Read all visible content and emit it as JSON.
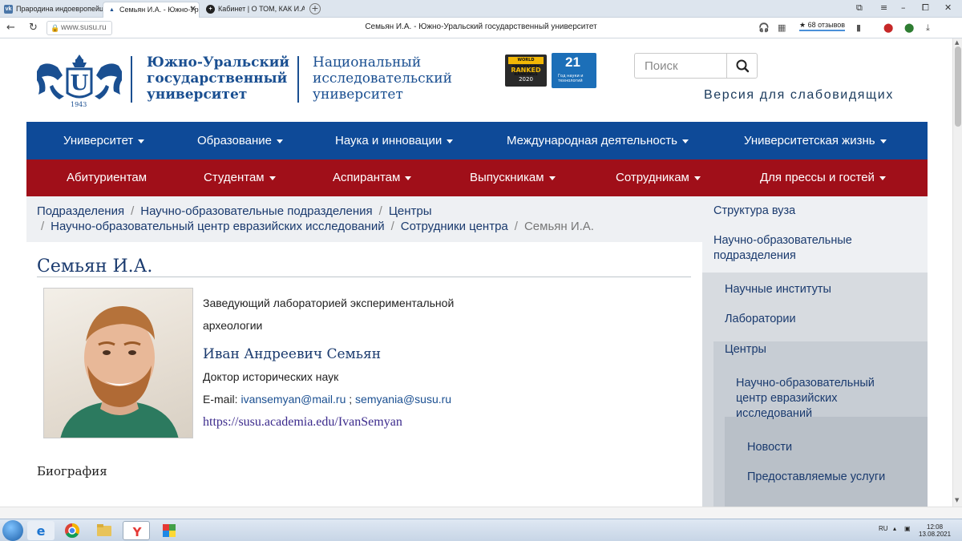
{
  "browser": {
    "tabs": [
      {
        "label": "Прародина индоевропейцев",
        "active": false,
        "favicon": "vk-icon"
      },
      {
        "label": "Семьян И.А. - Южно-Уральский",
        "active": true,
        "favicon": "susu-icon"
      },
      {
        "label": "Кабинет | О ТОМ, КАК И.А.",
        "active": false,
        "favicon": "cabinet-icon"
      }
    ],
    "url": "www.susu.ru",
    "page_title": "Семьян И.А. - Южно-Уральский государственный университет",
    "reviews": "68 отзывов"
  },
  "header": {
    "univ_name": [
      "Южно-Уральский",
      "государственный",
      "университет"
    ],
    "univ_sub": [
      "Национальный",
      "исследовательский",
      "университет"
    ],
    "founded": "1943",
    "badge_ranked": "RANKED",
    "badge_ranked_top": "WORLD UNIVERSITY RANKINGS",
    "badge_ranked_year": "2020",
    "badge_21": "21",
    "badge_21_text": "Год науки и технологий",
    "search_placeholder": "Поиск",
    "vision_link": "Версия для слабовидящих"
  },
  "menu_main": [
    {
      "label": "Университет",
      "dropdown": true
    },
    {
      "label": "Образование",
      "dropdown": true
    },
    {
      "label": "Наука и инновации",
      "dropdown": true
    },
    {
      "label": "Международная деятельность",
      "dropdown": true
    },
    {
      "label": "Университетская жизнь",
      "dropdown": true
    }
  ],
  "menu_audience": [
    {
      "label": "Абитуриентам",
      "dropdown": false
    },
    {
      "label": "Студентам",
      "dropdown": true
    },
    {
      "label": "Аспирантам",
      "dropdown": true
    },
    {
      "label": "Выпускникам",
      "dropdown": true
    },
    {
      "label": "Сотрудникам",
      "dropdown": true
    },
    {
      "label": "Для прессы и гостей",
      "dropdown": true
    }
  ],
  "breadcrumb": {
    "items": [
      "Подразделения",
      "Научно-образовательные подразделения",
      "Центры",
      "Научно-образовательный центр евразийских исследований",
      "Сотрудники центра"
    ],
    "current": "Семьян И.А.",
    "separator": "/"
  },
  "profile": {
    "heading": "Семьян И.А.",
    "position": "Заведующий лабораторией экспериментальной археологии",
    "full_name": "Иван Андреевич Семьян",
    "degree": "Доктор исторических наук",
    "email_label": "E-mail:",
    "email1": "ivansemyan@mail.ru",
    "email_sep": ";",
    "email2": "semyania@susu.ru",
    "academia_url": "https://susu.academia.edu/IvanSemyan",
    "bio_title": "Биография"
  },
  "sidebar": {
    "items": [
      {
        "label": "Структура вуза",
        "level": 0
      },
      {
        "label": "Научно-образовательные подразделения",
        "level": 0
      },
      {
        "label": "Научные институты",
        "level": 1
      },
      {
        "label": "Лаборатории",
        "level": 1
      },
      {
        "label": "Центры",
        "level": 1
      },
      {
        "label": "Научно-образовательный центр евразийских исследований",
        "level": 2
      },
      {
        "label": "Новости",
        "level": 3
      },
      {
        "label": "Предоставляемые услуги",
        "level": 3
      }
    ]
  },
  "taskbar": {
    "lang": "RU",
    "time": "12:08",
    "date": "13.08.2021"
  },
  "colors": {
    "menu_blue": "#0e4a98",
    "menu_red": "#a00f19",
    "link": "#1a3a6e"
  }
}
